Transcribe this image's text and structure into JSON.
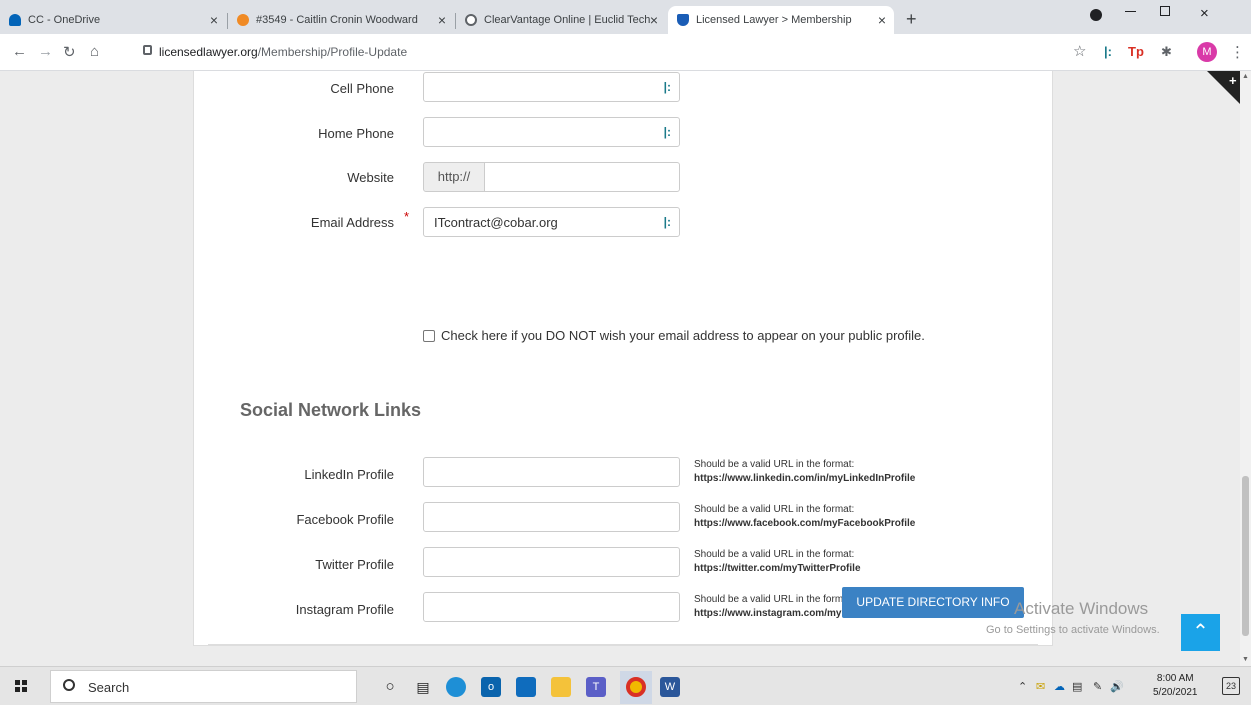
{
  "browser": {
    "tabs": [
      {
        "title": "CC - OneDrive",
        "icon": "onedrive-icon",
        "color": "#0364b8"
      },
      {
        "title": "#3549 - Caitlin Cronin Woodward",
        "icon": "ticket-icon",
        "color": "#f08a24"
      },
      {
        "title": "ClearVantage Online | Euclid Tech",
        "icon": "globe-icon",
        "color": "#5f6368"
      },
      {
        "title": "Licensed Lawyer > Membership",
        "icon": "shield-icon",
        "color": "#1a5db6"
      }
    ],
    "close_glyph": "×",
    "new_tab_glyph": "+",
    "url_host": "licensedlawyer.org",
    "url_path": "/Membership/Profile-Update",
    "avatar_initial": "M"
  },
  "form": {
    "cell_phone_label": "Cell Phone",
    "home_phone_label": "Home Phone",
    "website_label": "Website",
    "website_prefix": "http://",
    "email_label": "Email Address",
    "email_required_mark": "*",
    "email_value": "ITcontract@cobar.org",
    "hide_email_checkbox_label": "Check here if you DO NOT wish your email address to appear on your public profile.",
    "social_section_title": "Social Network Links",
    "hint_prefix": "Should be a valid URL in the format:",
    "linkedin_label": "LinkedIn Profile",
    "linkedin_hint_url": "https://www.linkedin.com/in/myLinkedInProfile",
    "facebook_label": "Facebook Profile",
    "facebook_hint_url": "https://www.facebook.com/myFacebookProfile",
    "twitter_label": "Twitter Profile",
    "twitter_hint_url": "https://twitter.com/myTwitterProfile",
    "instagram_label": "Instagram Profile",
    "instagram_hint_url": "https://www.instagram.com/myInstagramProfile/",
    "submit_label": "UPDATE DIRECTORY INFO"
  },
  "overlay": {
    "activate_title": "Activate Windows",
    "activate_sub": "Go to Settings to activate Windows."
  },
  "taskbar": {
    "search_text": "Search",
    "time": "8:00 AM",
    "date": "5/20/2021",
    "notification_count": "23"
  },
  "colors": {
    "primary_button": "#3b82c4",
    "scroll_to_top": "#1aa3e8",
    "required": "#cc0000"
  }
}
